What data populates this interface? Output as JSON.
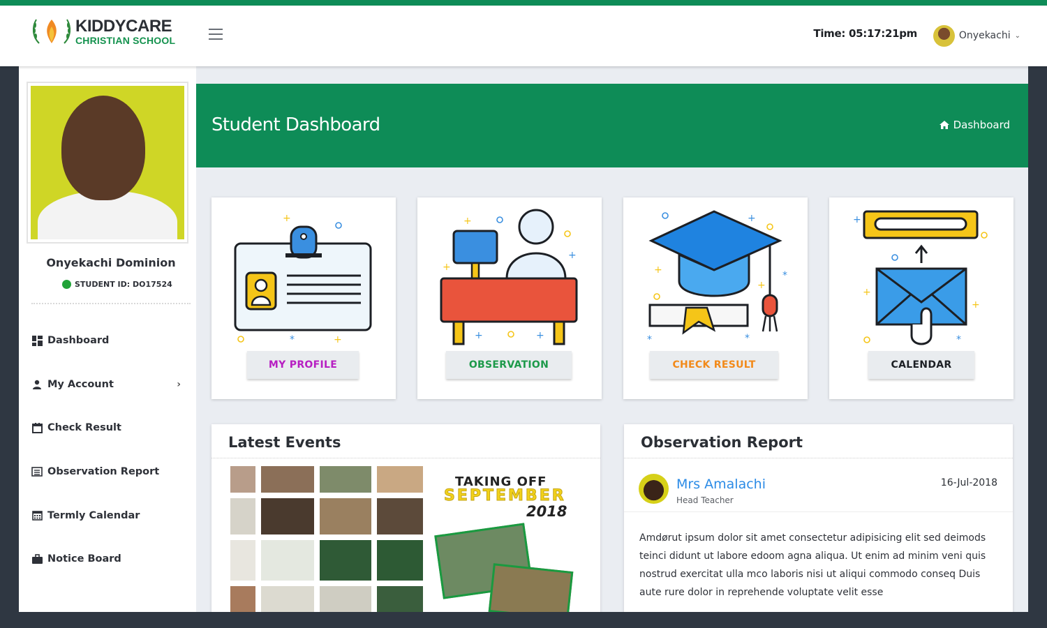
{
  "header": {
    "logo_line1": "KIDDYCARE",
    "logo_line2": "CHRISTIAN SCHOOL",
    "menu_icon": "hamburger-icon",
    "time": "Time: 05:17:21pm",
    "user_name": "Onyekachi",
    "brand_color": "#0e8c57"
  },
  "sidebar": {
    "student_name": "Onyekachi Dominion",
    "student_id": "STUDENT ID: DO17524",
    "status_color": "#21a338",
    "items": [
      {
        "label": "Dashboard",
        "icon": "dashboard-grid-icon"
      },
      {
        "label": "My Account",
        "icon": "user-icon"
      },
      {
        "label": "Check Result",
        "icon": "calendar-check-icon"
      },
      {
        "label": "Observation Report",
        "icon": "list-alt-icon"
      },
      {
        "label": "Termly Calendar",
        "icon": "calendar-grid-icon"
      },
      {
        "label": "Notice Board",
        "icon": "briefcase-icon"
      }
    ]
  },
  "banner": {
    "title": "Student Dashboard",
    "breadcrumb": "Dashboard"
  },
  "cards": [
    {
      "label": "MY PROFILE",
      "color": "#b71fc2",
      "icon": "id-badge-icon"
    },
    {
      "label": "OBSERVATION",
      "color": "#1d9a4a",
      "icon": "teacher-desk-icon"
    },
    {
      "label": "CHECK RESULT",
      "color": "#f28a1a",
      "icon": "graduation-cap-icon"
    },
    {
      "label": "CALENDAR",
      "color": "#1c1f24",
      "icon": "mail-calendar-icon"
    }
  ],
  "events": {
    "title": "Latest Events",
    "poster_line1": "TAKING OFF",
    "poster_line2": "SEPTEMBER",
    "poster_line3": "2018"
  },
  "observation": {
    "title": "Observation Report",
    "teacher": "Mrs Amalachi",
    "role": "Head Teacher",
    "date": "16-Jul-2018",
    "text": "Amdørut ipsum dolor sit amet consectetur adipisicing elit sed deimods teinci didunt ut labore edoom agna aliqua. Ut enim ad minim veni quis nostrud exercitat ulla mco laboris nisi ut aliqui commodo conseq Duis aute rure dolor in reprehende voluptate velit esse"
  }
}
